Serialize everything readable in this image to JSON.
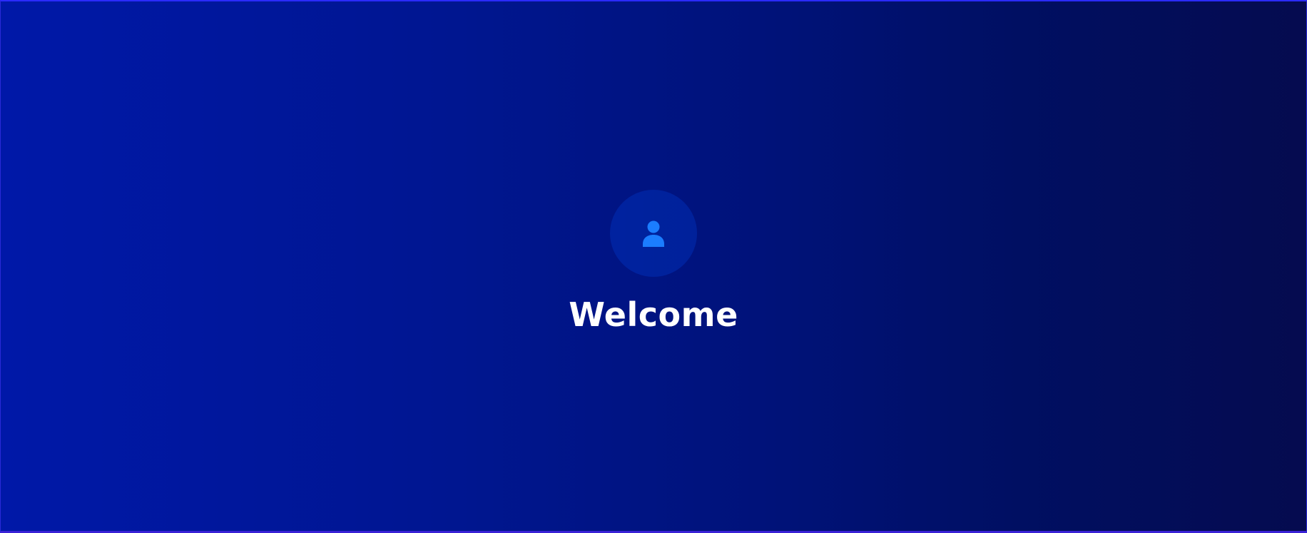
{
  "welcome": {
    "title": "Welcome",
    "icon": "user-icon",
    "colors": {
      "icon": "#1b7dff",
      "avatar_bg": "rgba(0,86,255,0.22)",
      "gradient_start": "#0018a8",
      "gradient_end": "#050b4f",
      "title": "#ffffff"
    }
  }
}
